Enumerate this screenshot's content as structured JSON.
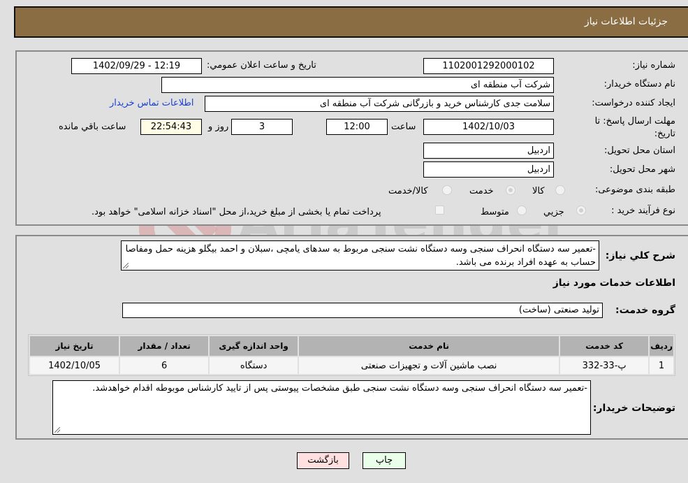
{
  "header": {
    "title": "جزئیات اطلاعات نیاز"
  },
  "form": {
    "need_number_label": "شماره نیاز:",
    "need_number": "1102001292000102",
    "announce_label": "تاریخ و ساعت اعلان عمومي:",
    "announce_value": "1402/09/29 - 12:19",
    "buyer_org_label": "نام دستگاه خریدار:",
    "buyer_org": "شرکت آب منطقه ای",
    "creator_label": "ایجاد کننده درخواست:",
    "creator": "سلامت جدی کارشناس خرید و بازرگانی شرکت آب منطقه ای",
    "contact_link": "اطلاعات تماس خریدار",
    "deadline_label": "مهلت ارسال پاسخ: تا تاریخ:",
    "deadline_date": "1402/10/03",
    "time_label": "ساعت",
    "deadline_time": "12:00",
    "days_value": "3",
    "days_label": "روز و",
    "remaining_time": "22:54:43",
    "remaining_label": "ساعت باقي مانده",
    "province_label": "استان محل تحویل:",
    "province": "اردبیل",
    "city_label": "شهر محل تحویل:",
    "city": "اردبیل",
    "category_label": "طبقه بندی موضوعی:",
    "category_options": [
      "کالا",
      "خدمت",
      "کالا/خدمت"
    ],
    "category_selected": "خدمت",
    "process_label": "نوع فرآیند خرید :",
    "process_options": [
      "جزیي",
      "متوسط"
    ],
    "process_selected": "جزیي",
    "treasury_note": "پرداخت تمام یا بخشی از مبلغ خرید،از محل \"اسناد خزانه اسلامی\" خواهد بود."
  },
  "details": {
    "description_label": "شرح کلي نیاز:",
    "description": "-تعمیر سه دستگاه انحراف سنجی وسه دستگاه نشت سنجی مربوط به سدهای یامچی ،سبلان و احمد بیگلو هزینه حمل ومفاصا حساب به عهده افراد برنده می باشد.",
    "services_heading": "اطلاعات خدمات مورد نیاز",
    "service_group_label": "گروه خدمت:",
    "service_group": "تولید صنعتی (ساخت)",
    "table": {
      "headers": [
        "ردیف",
        "کد خدمت",
        "نام خدمت",
        "واحد اندازه گیری",
        "تعداد / مقدار",
        "تاریخ نیاز"
      ],
      "rows": [
        [
          "1",
          "پ-33-332",
          "نصب ماشین آلات و تجهیزات صنعتی",
          "دستگاه",
          "6",
          "1402/10/05"
        ]
      ]
    },
    "buyer_notes_label": "توضیحات خریدار:",
    "buyer_notes": "-تعمیر سه دستگاه انحراف سنجی وسه دستگاه نشت سنجی طبق مشخصات پیوستی پس از تایید کارشناس موبوطه اقدام خواهدشد."
  },
  "buttons": {
    "print": "چاپ",
    "back": "بازگشت"
  },
  "colors": {
    "header_bg": "#8b6d43",
    "print_bg": "#eaffea",
    "back_bg": "#ffe0e0",
    "link": "#1a3fd8"
  }
}
